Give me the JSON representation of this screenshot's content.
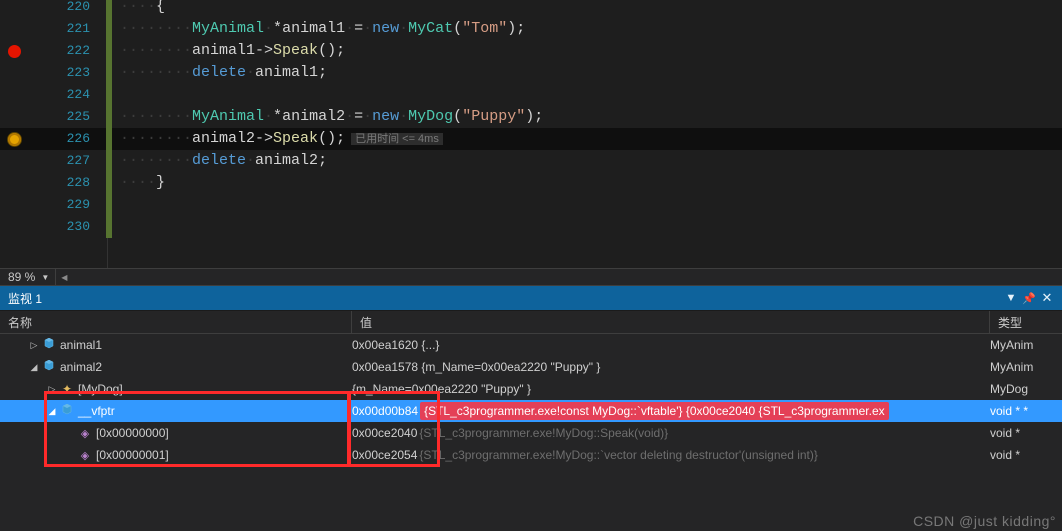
{
  "editor": {
    "zoom": "89 %",
    "elapsed_label": "已用时间 <= 4ms",
    "lines": [
      {
        "n": "220",
        "bp": "",
        "tokens": [
          [
            "ws",
            "····"
          ],
          [
            "punc",
            "{"
          ]
        ]
      },
      {
        "n": "221",
        "bp": "",
        "tokens": [
          [
            "ws",
            "········"
          ],
          [
            "type",
            "MyAnimal"
          ],
          [
            "ws",
            "·"
          ],
          [
            "op",
            "*"
          ],
          [
            "ident",
            "animal1"
          ],
          [
            "ws",
            "·"
          ],
          [
            "op",
            "="
          ],
          [
            "ws",
            "·"
          ],
          [
            "kw",
            "new"
          ],
          [
            "ws",
            "·"
          ],
          [
            "type",
            "MyCat"
          ],
          [
            "punc",
            "("
          ],
          [
            "str",
            "\"Tom\""
          ],
          [
            "punc",
            ")"
          ],
          [
            "punc",
            ";"
          ]
        ]
      },
      {
        "n": "222",
        "bp": "bp",
        "tokens": [
          [
            "ws",
            "········"
          ],
          [
            "ident",
            "animal1"
          ],
          [
            "op",
            "->"
          ],
          [
            "func",
            "Speak"
          ],
          [
            "punc",
            "()"
          ],
          [
            "punc",
            ";"
          ]
        ]
      },
      {
        "n": "223",
        "bp": "",
        "tokens": [
          [
            "ws",
            "········"
          ],
          [
            "kw",
            "delete"
          ],
          [
            "ws",
            "·"
          ],
          [
            "ident",
            "animal1"
          ],
          [
            "punc",
            ";"
          ]
        ]
      },
      {
        "n": "224",
        "bp": "",
        "tokens": []
      },
      {
        "n": "225",
        "bp": "",
        "tokens": [
          [
            "ws",
            "········"
          ],
          [
            "type",
            "MyAnimal"
          ],
          [
            "ws",
            "·"
          ],
          [
            "op",
            "*"
          ],
          [
            "ident",
            "animal2"
          ],
          [
            "ws",
            "·"
          ],
          [
            "op",
            "="
          ],
          [
            "ws",
            "·"
          ],
          [
            "kw",
            "new"
          ],
          [
            "ws",
            "·"
          ],
          [
            "type",
            "MyDog"
          ],
          [
            "punc",
            "("
          ],
          [
            "str",
            "\"Puppy\""
          ],
          [
            "punc",
            ")"
          ],
          [
            "punc",
            ";"
          ]
        ]
      },
      {
        "n": "226",
        "bp": "bp-cur",
        "current": true,
        "elapsed": true,
        "tokens": [
          [
            "ws",
            "········"
          ],
          [
            "ident",
            "animal2"
          ],
          [
            "op",
            "->"
          ],
          [
            "func",
            "Speak"
          ],
          [
            "punc",
            "()"
          ],
          [
            "punc",
            ";"
          ]
        ]
      },
      {
        "n": "227",
        "bp": "",
        "tokens": [
          [
            "ws",
            "········"
          ],
          [
            "kw",
            "delete"
          ],
          [
            "ws",
            "·"
          ],
          [
            "ident",
            "animal2"
          ],
          [
            "punc",
            ";"
          ]
        ]
      },
      {
        "n": "228",
        "bp": "",
        "tokens": [
          [
            "ws",
            "····"
          ],
          [
            "punc",
            "}"
          ]
        ]
      },
      {
        "n": "229",
        "bp": "",
        "tokens": []
      },
      {
        "n": "230",
        "bp": "",
        "tokens": []
      }
    ]
  },
  "watch": {
    "title": "监视 1",
    "headers": {
      "name": "名称",
      "value": "值",
      "type": "类型"
    },
    "rows": [
      {
        "indent": 0,
        "toggle": "▷",
        "icon": "class",
        "name": "animal1",
        "value": "0x00ea1620 {...}",
        "type": "MyAnim",
        "value_style": "plain"
      },
      {
        "indent": 0,
        "toggle": "◢",
        "icon": "class",
        "name": "animal2",
        "value": "0x00ea1578 {m_Name=0x00ea2220 \"Puppy\" }",
        "type": "MyAnim",
        "value_style": "plain"
      },
      {
        "indent": 1,
        "toggle": "▷",
        "icon": "star",
        "name": "[MyDog]",
        "value": "{m_Name=0x00ea2220 \"Puppy\" }",
        "type": "MyDog",
        "value_style": "plain"
      },
      {
        "indent": 1,
        "toggle": "◢",
        "icon": "class",
        "name": "__vfptr",
        "selected": true,
        "value_pre": "0x00d00b84",
        "value_hl": "{STL_c3programmer.exe!const MyDog::`vftable'} {0x00ce2040 {STL_c3programmer.ex",
        "type": "void * *",
        "value_style": "hl"
      },
      {
        "indent": 2,
        "toggle": "",
        "icon": "pub",
        "name": "[0x00000000]",
        "value_pre": "0x00ce2040",
        "value_grey": "{STL_c3programmer.exe!MyDog::Speak(void)}",
        "type": "void *",
        "value_style": "grey"
      },
      {
        "indent": 2,
        "toggle": "",
        "icon": "pub",
        "name": "[0x00000001]",
        "value_pre": "0x00ce2054",
        "value_grey": "{STL_c3programmer.exe!MyDog::`vector deleting destructor'(unsigned int)}",
        "type": "void *",
        "value_style": "grey"
      }
    ]
  },
  "watermark": "CSDN @just kidding°"
}
